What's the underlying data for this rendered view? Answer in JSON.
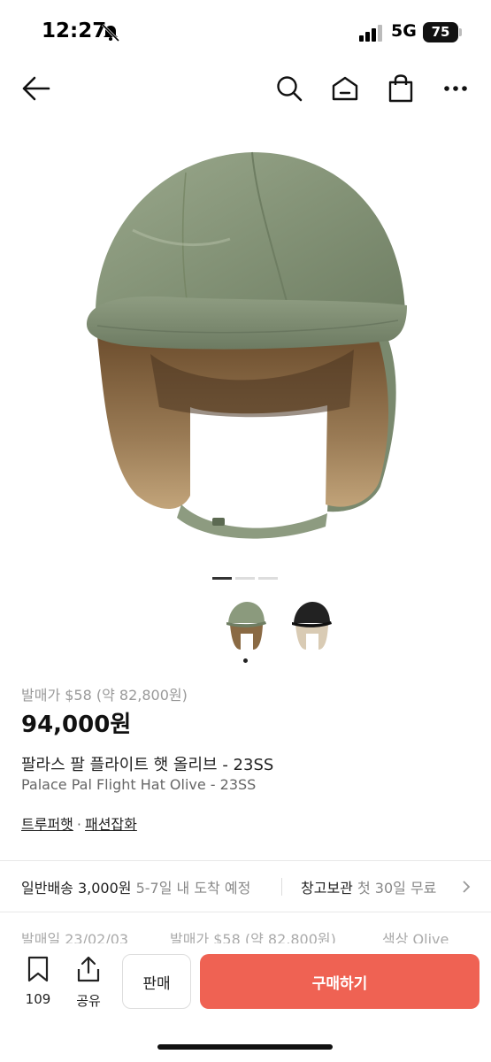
{
  "status_bar": {
    "time": "12:27",
    "network": "5G",
    "battery": "75"
  },
  "nav": {
    "back_icon": "arrow-left-icon",
    "search_icon": "search-icon",
    "home_icon": "home-icon",
    "bag_icon": "shopping-bag-icon",
    "more_icon": "more-horizontal-icon"
  },
  "gallery": {
    "slide_count": 3,
    "active_slide": 1
  },
  "product": {
    "release_price": "발매가 $58 (약 82,800원)",
    "price": "94,000원",
    "name_ko": "팔라스 팔 플라이트 햇 올리브 - 23SS",
    "name_en": "Palace Pal Flight Hat Olive - 23SS",
    "category_primary": "트루퍼햇",
    "category_separator": "·",
    "category_secondary": "패션잡화"
  },
  "shipping": {
    "method": "일반배송 3,000원",
    "eta": "5-7일 내 도착 예정",
    "storage_label": "창고보관",
    "storage_detail": "첫 30일 무료"
  },
  "meta": {
    "release_date": "발매일 23/02/03",
    "release_price": "발매가 $58 (약 82,800원)",
    "color": "색상 Olive"
  },
  "bottom_bar": {
    "bookmark_count": "109",
    "share_label": "공유",
    "sell_label": "판매",
    "buy_label": "구매하기"
  },
  "colors": {
    "buy_button": "#ef6253",
    "hat_olive": "#8b9a7d",
    "fur": "#8a6a44"
  }
}
